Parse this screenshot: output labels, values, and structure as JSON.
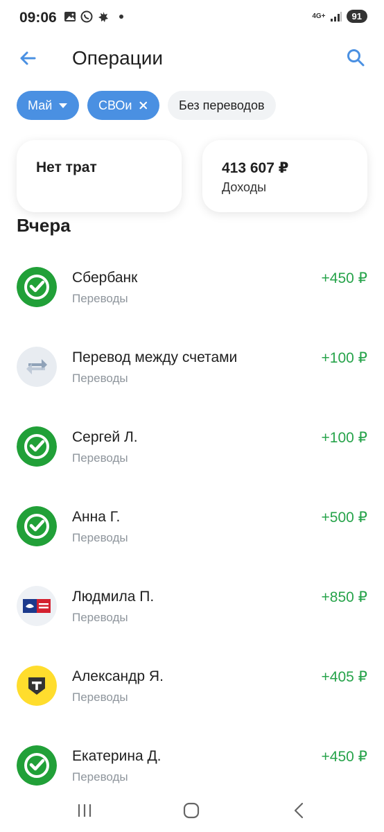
{
  "status_bar": {
    "time": "09:06",
    "network": "4G+",
    "battery": "91",
    "icons": [
      "gallery-icon",
      "whatsapp-icon",
      "app-icon",
      "dot-icon",
      "signal-icon",
      "battery-icon"
    ]
  },
  "header": {
    "title": "Операции",
    "back_icon": "arrow-left-icon",
    "search_icon": "search-icon"
  },
  "filters": [
    {
      "label": "Май",
      "type": "dropdown",
      "selected": true
    },
    {
      "label": "СВОи",
      "type": "removable",
      "selected": true
    },
    {
      "label": "Без переводов",
      "type": "toggle",
      "selected": false
    }
  ],
  "summary": {
    "expenses": {
      "label": "Нет трат"
    },
    "income": {
      "value": "413 607 ₽",
      "label": "Доходы"
    }
  },
  "section_title": "Вчера",
  "transactions": [
    {
      "name": "Сбербанк",
      "category": "Переводы",
      "amount": "+450 ₽",
      "icon": "sber-icon"
    },
    {
      "name": "Перевод между счетами",
      "category": "Переводы",
      "amount": "+100 ₽",
      "icon": "transfer-arrows-icon"
    },
    {
      "name": "Сергей Л.",
      "category": "Переводы",
      "amount": "+100 ₽",
      "icon": "sber-icon"
    },
    {
      "name": "Анна Г.",
      "category": "Переводы",
      "amount": "+500 ₽",
      "icon": "sber-icon"
    },
    {
      "name": "Людмила П.",
      "category": "Переводы",
      "amount": "+850 ₽",
      "icon": "pochta-bank-icon"
    },
    {
      "name": "Александр Я.",
      "category": "Переводы",
      "amount": "+405 ₽",
      "icon": "tbank-icon"
    },
    {
      "name": "Екатерина Д.",
      "category": "Переводы",
      "amount": "+450 ₽",
      "icon": "sber-icon"
    }
  ],
  "colors": {
    "accent_blue": "#4a90e2",
    "income_green": "#26a34a",
    "sber_green": "#21a038",
    "tbank_yellow": "#ffdd2d",
    "muted_text": "#8e959c"
  },
  "nav": [
    "recents-icon",
    "home-icon",
    "back-nav-icon"
  ]
}
